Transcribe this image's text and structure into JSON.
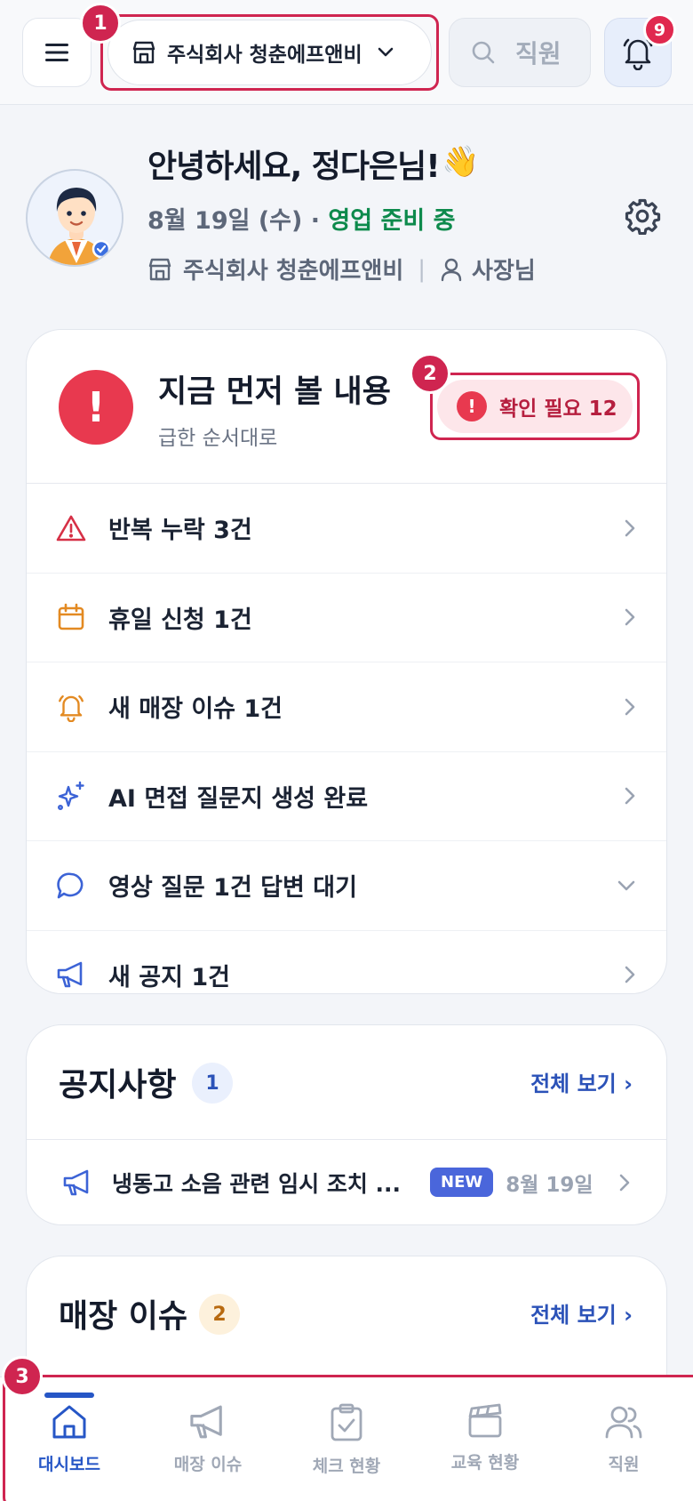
{
  "header": {
    "store_name": "주식회사 청춘에프앤비",
    "search_placeholder": "직원",
    "notification_count": "9",
    "step_badges": [
      "1",
      "2",
      "3"
    ]
  },
  "profile": {
    "greeting": "안녕하세요, 정다은님!",
    "greeting_emoji": "👋",
    "date": "8월 19일 (수) · ",
    "status": "영업 준비 중",
    "store": "주식회사 청춘에프앤비",
    "separator": "|",
    "role": "사장님"
  },
  "alerts": {
    "title": "지금 먼저 볼 내용",
    "subtitle": "급한 순서대로",
    "need_check_label": "확인 필요 12",
    "items": [
      {
        "label": "반복 누락 3건",
        "icon": "warning-icon"
      },
      {
        "label": "휴일 신청 1건",
        "icon": "calendar-icon"
      },
      {
        "label": "새 매장 이슈 1건",
        "icon": "bell-ring-icon"
      },
      {
        "label": "AI 면접 질문지 생성 완료",
        "icon": "sparkle-icon"
      },
      {
        "label": "영상 질문 1건 답변 대기",
        "icon": "chat-bubble-icon"
      },
      {
        "label": "새 공지 1건",
        "icon": "megaphone-icon"
      }
    ]
  },
  "notices": {
    "title": "공지사항",
    "count": "1",
    "see_all": "전체 보기 ›",
    "item_text": "냉동고 소음 관련 임시 조치 ...",
    "item_badge": "NEW",
    "item_date": "8월 19일"
  },
  "issues": {
    "title": "매장 이슈",
    "count": "2",
    "see_all": "전체 보기 ›"
  },
  "nav": {
    "items": [
      {
        "label": "대시보드",
        "icon": "home-icon",
        "active": true
      },
      {
        "label": "매장 이슈",
        "icon": "megaphone-icon",
        "active": false
      },
      {
        "label": "체크 현황",
        "icon": "clipboard-check-icon",
        "active": false
      },
      {
        "label": "교육 현황",
        "icon": "clapperboard-icon",
        "active": false
      },
      {
        "label": "직원",
        "icon": "users-icon",
        "active": false
      }
    ]
  },
  "colors": {
    "accent_blue": "#2656c6",
    "alert_red": "#e8394f",
    "highlight": "#cf2550",
    "status_green": "#0d8a4c"
  }
}
